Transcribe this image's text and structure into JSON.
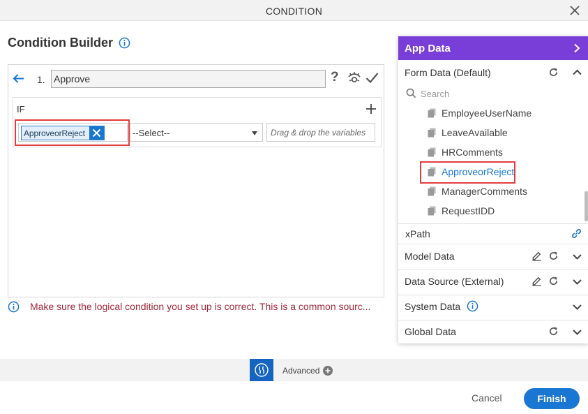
{
  "dialog": {
    "title": "CONDITION"
  },
  "builder": {
    "title": "Condition Builder",
    "row_number": "1.",
    "row_name": "Approve",
    "help_glyph": "?",
    "if_label": "IF",
    "variable_chip": "ApproveorReject",
    "operator_select": "--Select--",
    "drop_placeholder": "Drag & drop the variables"
  },
  "warning": {
    "text": "Make sure the logical condition you set up is correct. This is a common sourc..."
  },
  "footer": {
    "advanced_label": "Advanced",
    "cancel_label": "Cancel",
    "finish_label": "Finish"
  },
  "app_data": {
    "title": "App Data",
    "form_data": {
      "title": "Form Data (Default)",
      "search_placeholder": "Search",
      "fields": [
        "EmployeeUserName",
        "LeaveAvailable",
        "HRComments",
        "ApproveorReject",
        "ManagerComments",
        "RequestIDD"
      ],
      "highlighted": "ApproveorReject"
    },
    "xpath_label": "xPath",
    "sections": [
      "Model Data",
      "Data Source (External)",
      "System Data",
      "Global Data"
    ]
  },
  "colors": {
    "accent": "#1976d2",
    "panel_header": "#7a3ed8",
    "warning_text": "#a3283b",
    "highlight_border": "#e23d3d"
  },
  "icons": [
    "close-icon",
    "info-icon",
    "back-arrow-icon",
    "help-icon",
    "visibility-icon",
    "check-icon",
    "plus-icon",
    "remove-icon",
    "caret-down-icon",
    "chevron-right-icon",
    "refresh-icon",
    "chevron-up-icon",
    "chevron-down-icon",
    "search-icon",
    "field-icon",
    "link-icon",
    "edit-icon",
    "advanced-icon",
    "plus-circle-icon"
  ]
}
